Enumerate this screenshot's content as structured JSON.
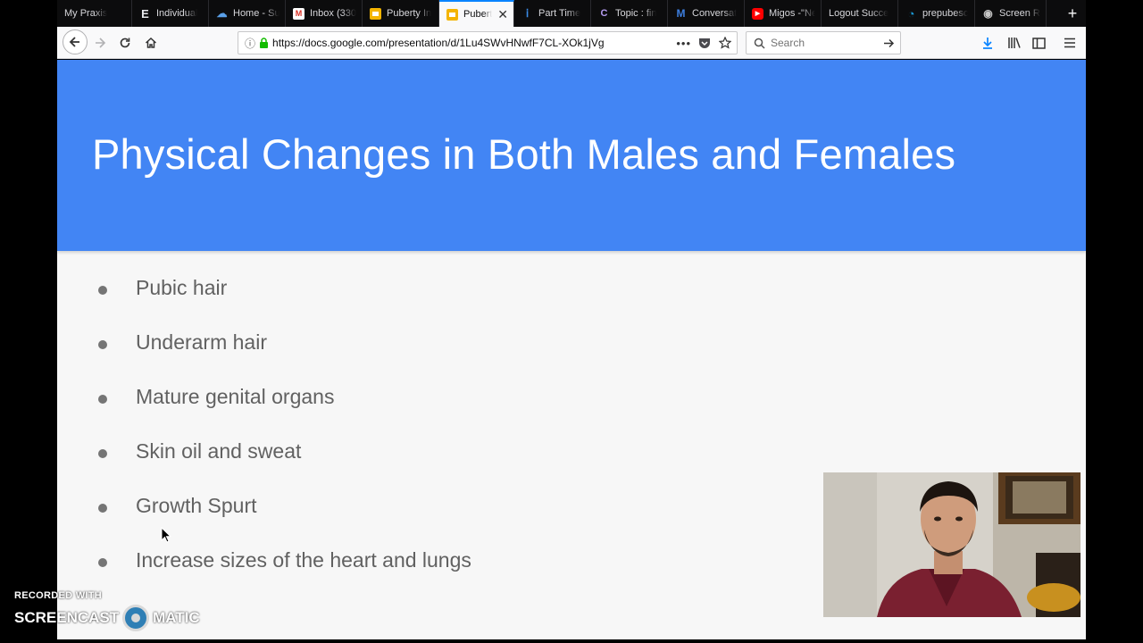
{
  "browser": {
    "tabs": [
      {
        "label": "My Praxis",
        "icon": "praxis-icon",
        "color": "#1f1f1f",
        "glyph": ""
      },
      {
        "label": "Individual",
        "icon": "e-icon",
        "color": "#1f1f1f",
        "glyph": "E"
      },
      {
        "label": "Home - Su",
        "icon": "cloud-icon",
        "color": "#4a90d9",
        "glyph": "☁"
      },
      {
        "label": "Inbox (330",
        "icon": "gmail-icon",
        "color": "#d93025",
        "glyph": "M"
      },
      {
        "label": "Puberty In",
        "icon": "slides-icon",
        "color": "#f4b400",
        "glyph": ""
      },
      {
        "label": "Pubert",
        "icon": "slides-icon",
        "color": "#f4b400",
        "glyph": "",
        "active": true
      },
      {
        "label": "Part Time",
        "icon": "pin-icon",
        "color": "#1a73e8",
        "glyph": "ⅰ"
      },
      {
        "label": "Topic : fin",
        "icon": "cc-icon",
        "color": "#5b3fa8",
        "glyph": "C"
      },
      {
        "label": "Conversat",
        "icon": "m-icon",
        "color": "#0f4c9e",
        "glyph": "M"
      },
      {
        "label": "Migos -\"Ne",
        "icon": "youtube-icon",
        "color": "#ff0000",
        "glyph": "▶"
      },
      {
        "label": "Logout Succe",
        "icon": "blank-icon",
        "color": "",
        "glyph": ""
      },
      {
        "label": "prepubesc",
        "icon": "circle-icon",
        "color": "#1a9bd7",
        "glyph": "◔"
      },
      {
        "label": "Screen Re",
        "icon": "record-icon",
        "color": "#6b6b6b",
        "glyph": "◉"
      }
    ],
    "address": {
      "url": "https://docs.google.com/presentation/d/1Lu4SWvHNwfF7CL-XOk1jVg"
    },
    "search": {
      "placeholder": "Search"
    }
  },
  "slide": {
    "title": "Physical Changes in Both Males and Females",
    "bullets": [
      "Pubic hair",
      "Underarm hair",
      "Mature genital organs",
      "Skin oil and sweat",
      "Growth Spurt",
      "Increase sizes of the heart and lungs"
    ]
  },
  "watermark": {
    "recorded_with": "RECORDED WITH",
    "brand_left": "SCREENCAST",
    "brand_right": "MATIC"
  },
  "colors": {
    "slide_header": "#4285f4",
    "bullet_text": "#616161",
    "tab_accent": "#0a84ff"
  }
}
